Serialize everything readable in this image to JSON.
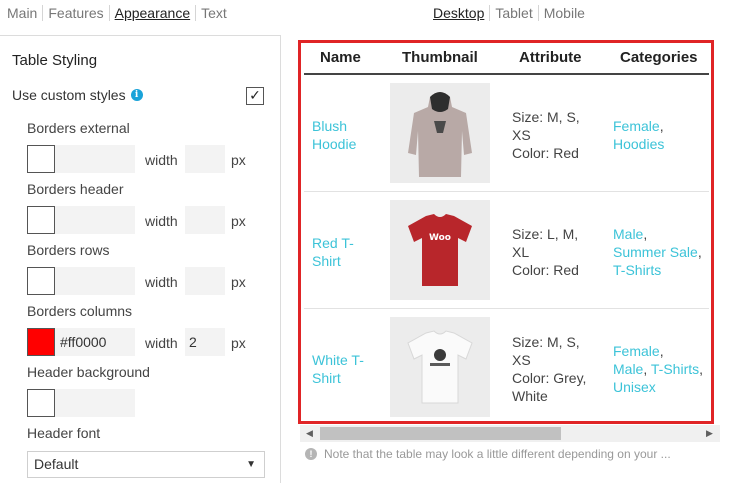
{
  "tabs": [
    {
      "label": "Main",
      "active": false
    },
    {
      "label": "Features",
      "active": false
    },
    {
      "label": "Appearance",
      "active": true
    },
    {
      "label": "Text",
      "active": false
    }
  ],
  "device_tabs": [
    {
      "label": "Desktop",
      "active": true
    },
    {
      "label": "Tablet",
      "active": false
    },
    {
      "label": "Mobile",
      "active": false
    }
  ],
  "panel": {
    "title": "Table Styling",
    "use_custom_label": "Use custom styles",
    "use_custom_checked": true,
    "check_glyph": "✓",
    "width_label": "width",
    "unit": "px",
    "fields": [
      {
        "label": "Borders external",
        "color": "",
        "width": ""
      },
      {
        "label": "Borders header",
        "color": "",
        "width": ""
      },
      {
        "label": "Borders rows",
        "color": "",
        "width": ""
      },
      {
        "label": "Borders columns",
        "color": "#ff0000",
        "width": "2"
      }
    ],
    "header_bg_label": "Header background",
    "header_font_label": "Header font",
    "header_font_value": "Default"
  },
  "table": {
    "headers": [
      "Name",
      "Thumbnail",
      "Attribute",
      "Categories"
    ],
    "rows": [
      {
        "name": "Blush Hoodie",
        "thumb": "hoodie",
        "attr_line1": "Size: M, S,",
        "attr_line2": "XS",
        "attr_line3": "Color: Red",
        "attr_line4": "",
        "cat1": "Female",
        "cat2": "Hoodies"
      },
      {
        "name": "Red T-Shirt",
        "thumb": "red-tshirt",
        "attr_line1": "Size: L, M,",
        "attr_line2": "XL",
        "attr_line3": "Color: Red",
        "attr_line4": "",
        "cat1": "Male",
        "cat2": "Summer Sale",
        "cat3": "T-Shirts"
      },
      {
        "name": "White T-Shirt",
        "thumb": "white-tshirt",
        "attr_line1": "Size: M, S,",
        "attr_line2": "XS",
        "attr_line3": "Color: Grey,",
        "attr_line4": "White",
        "cat1": "Female",
        "cat2": "Male",
        "cat3": "T-Shirts",
        "cat4": "Unisex"
      }
    ]
  },
  "note": "Note that the table may look a little different depending on your ...",
  "colors": {
    "accent": "#3cc3d8",
    "border_highlight": "#e02426",
    "info": "#1aa3d9"
  },
  "icons": {
    "info": "info-icon",
    "note": "note-info-icon",
    "dropdown": "chevron-down-icon"
  }
}
